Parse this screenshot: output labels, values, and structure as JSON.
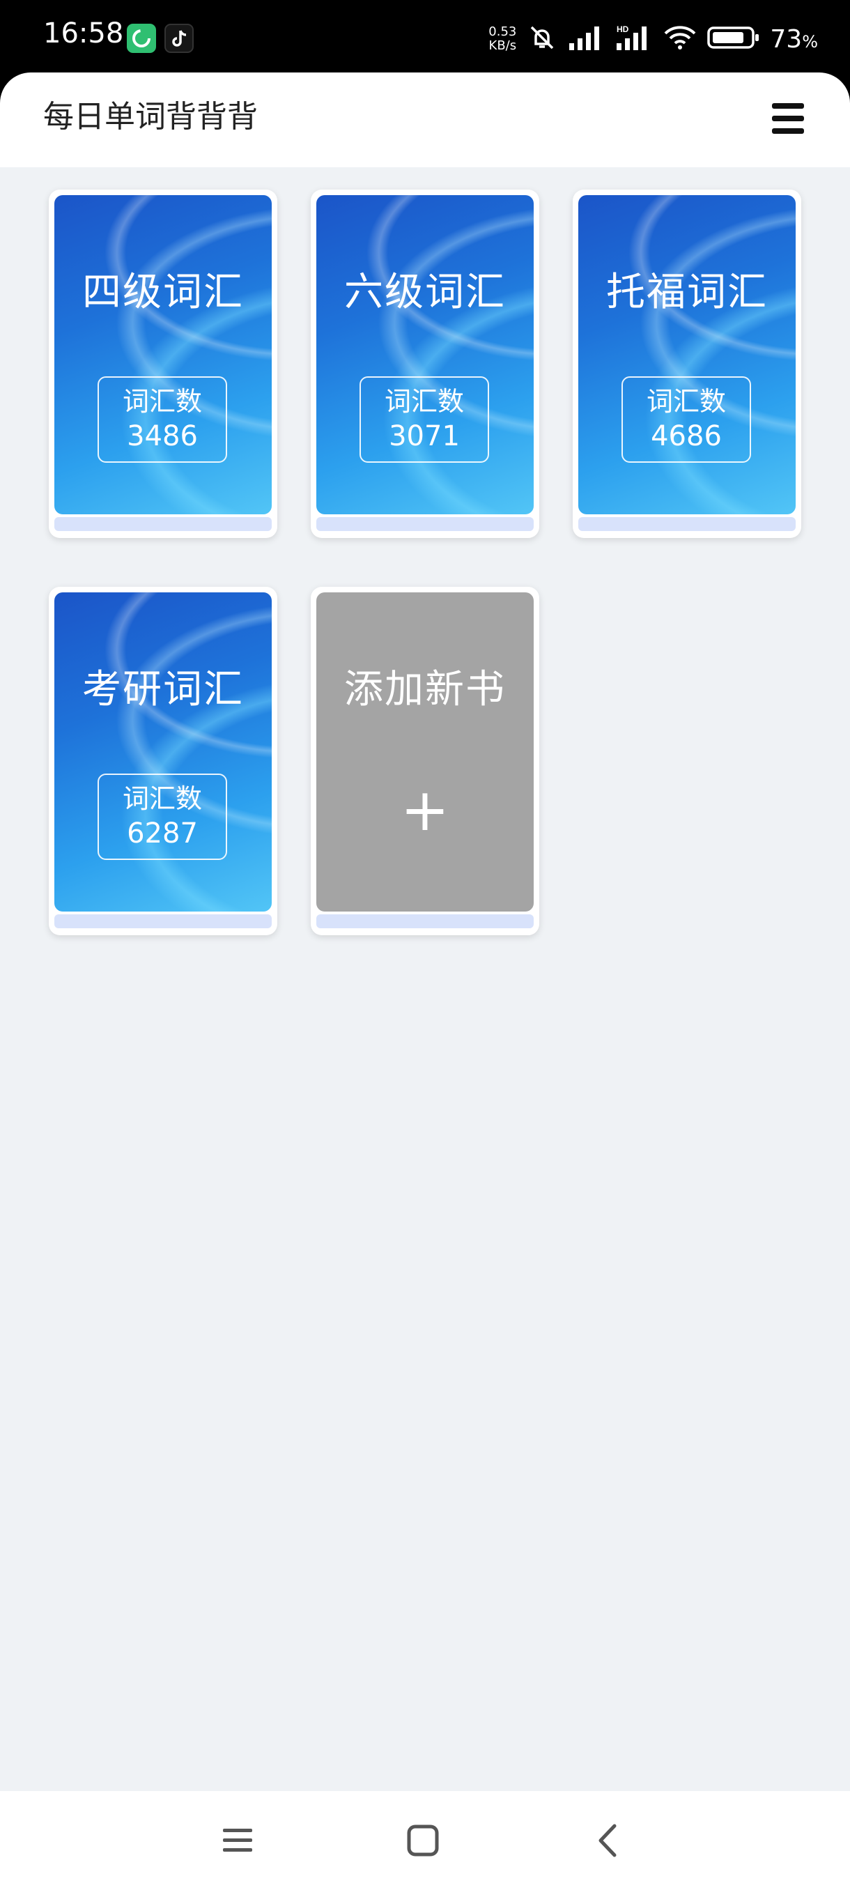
{
  "status_bar": {
    "time": "16:58",
    "net_speed_value": "0.53",
    "net_speed_unit": "KB/s",
    "battery_percent": "73",
    "battery_unit": "%"
  },
  "header": {
    "title": "每日单词背背背"
  },
  "books": [
    {
      "title": "四级词汇",
      "count_label": "词汇数",
      "count": "3486"
    },
    {
      "title": "六级词汇",
      "count_label": "词汇数",
      "count": "3071"
    },
    {
      "title": "托福词汇",
      "count_label": "词汇数",
      "count": "4686"
    },
    {
      "title": "考研词汇",
      "count_label": "词汇数",
      "count": "6287"
    }
  ],
  "add_book": {
    "title": "添加新书",
    "plus": "+"
  },
  "colors": {
    "cover_blue": "#1e72d9",
    "add_gray": "#a4a4a4",
    "background": "#eff2f5"
  },
  "icons": {
    "menu": "hamburger-menu-icon",
    "nav_recent": "recent-apps-icon",
    "nav_home": "home-icon",
    "nav_back": "back-icon"
  }
}
